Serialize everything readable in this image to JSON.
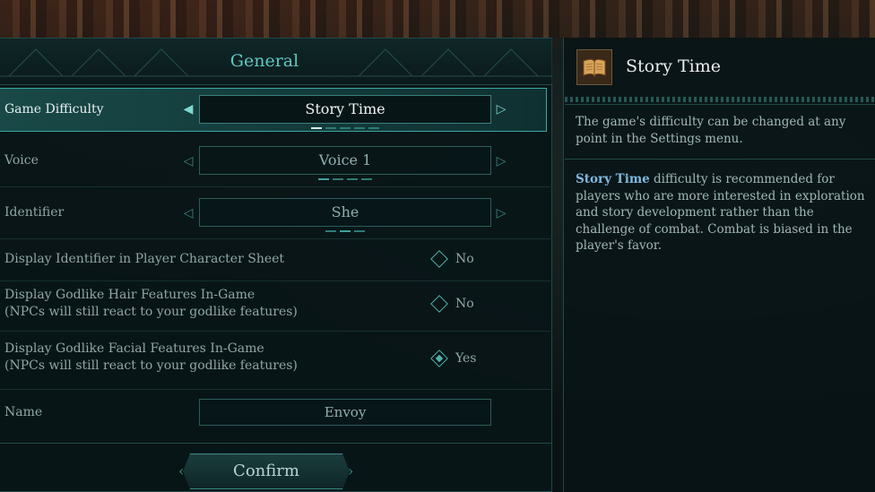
{
  "panel": {
    "title": "General"
  },
  "settings": {
    "difficulty": {
      "label": "Game Difficulty",
      "value": "Story Time",
      "dots": 5,
      "active_dot": 0
    },
    "voice": {
      "label": "Voice",
      "value": "Voice 1",
      "dots": 4,
      "active_dot": 0
    },
    "identifier": {
      "label": "Identifier",
      "value": "She",
      "dots": 3,
      "active_dot": 1
    },
    "display_identifier": {
      "label": "Display Identifier in Player Character Sheet",
      "value": "No",
      "checked": false
    },
    "godlike_hair": {
      "label": "Display Godlike Hair Features In-Game",
      "sublabel": "(NPCs will still react to your godlike features)",
      "value": "No",
      "checked": false
    },
    "godlike_facial": {
      "label": "Display Godlike Facial Features In-Game",
      "sublabel": "(NPCs will still react to your godlike features)",
      "value": "Yes",
      "checked": true
    },
    "name": {
      "label": "Name",
      "value": "Envoy"
    }
  },
  "confirm_label": "Confirm",
  "info": {
    "title": "Story Time",
    "icon": "book-icon",
    "para1": "The game's difficulty can be changed at any point in the Settings menu.",
    "para2_highlight": "Story Time",
    "para2_rest": " difficulty is recommended for players who are more interested in exploration and story development rather than the challenge of combat. Combat is biased in the player's favor."
  },
  "colors": {
    "accent": "#5ec9c2",
    "selected_row": "#1e5a58",
    "highlight_text": "#7fb8e0"
  }
}
